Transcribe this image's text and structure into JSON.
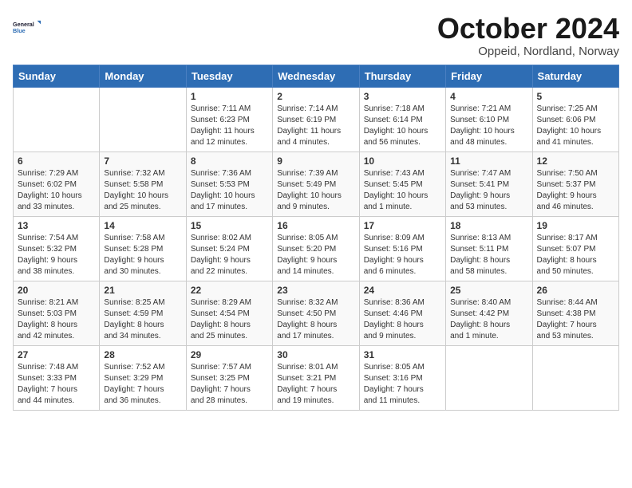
{
  "logo": {
    "text_general": "General",
    "text_blue": "Blue"
  },
  "title": "October 2024",
  "subtitle": "Oppeid, Nordland, Norway",
  "days_of_week": [
    "Sunday",
    "Monday",
    "Tuesday",
    "Wednesday",
    "Thursday",
    "Friday",
    "Saturday"
  ],
  "weeks": [
    [
      {
        "day": "",
        "info": ""
      },
      {
        "day": "",
        "info": ""
      },
      {
        "day": "1",
        "info": "Sunrise: 7:11 AM\nSunset: 6:23 PM\nDaylight: 11 hours\nand 12 minutes."
      },
      {
        "day": "2",
        "info": "Sunrise: 7:14 AM\nSunset: 6:19 PM\nDaylight: 11 hours\nand 4 minutes."
      },
      {
        "day": "3",
        "info": "Sunrise: 7:18 AM\nSunset: 6:14 PM\nDaylight: 10 hours\nand 56 minutes."
      },
      {
        "day": "4",
        "info": "Sunrise: 7:21 AM\nSunset: 6:10 PM\nDaylight: 10 hours\nand 48 minutes."
      },
      {
        "day": "5",
        "info": "Sunrise: 7:25 AM\nSunset: 6:06 PM\nDaylight: 10 hours\nand 41 minutes."
      }
    ],
    [
      {
        "day": "6",
        "info": "Sunrise: 7:29 AM\nSunset: 6:02 PM\nDaylight: 10 hours\nand 33 minutes."
      },
      {
        "day": "7",
        "info": "Sunrise: 7:32 AM\nSunset: 5:58 PM\nDaylight: 10 hours\nand 25 minutes."
      },
      {
        "day": "8",
        "info": "Sunrise: 7:36 AM\nSunset: 5:53 PM\nDaylight: 10 hours\nand 17 minutes."
      },
      {
        "day": "9",
        "info": "Sunrise: 7:39 AM\nSunset: 5:49 PM\nDaylight: 10 hours\nand 9 minutes."
      },
      {
        "day": "10",
        "info": "Sunrise: 7:43 AM\nSunset: 5:45 PM\nDaylight: 10 hours\nand 1 minute."
      },
      {
        "day": "11",
        "info": "Sunrise: 7:47 AM\nSunset: 5:41 PM\nDaylight: 9 hours\nand 53 minutes."
      },
      {
        "day": "12",
        "info": "Sunrise: 7:50 AM\nSunset: 5:37 PM\nDaylight: 9 hours\nand 46 minutes."
      }
    ],
    [
      {
        "day": "13",
        "info": "Sunrise: 7:54 AM\nSunset: 5:32 PM\nDaylight: 9 hours\nand 38 minutes."
      },
      {
        "day": "14",
        "info": "Sunrise: 7:58 AM\nSunset: 5:28 PM\nDaylight: 9 hours\nand 30 minutes."
      },
      {
        "day": "15",
        "info": "Sunrise: 8:02 AM\nSunset: 5:24 PM\nDaylight: 9 hours\nand 22 minutes."
      },
      {
        "day": "16",
        "info": "Sunrise: 8:05 AM\nSunset: 5:20 PM\nDaylight: 9 hours\nand 14 minutes."
      },
      {
        "day": "17",
        "info": "Sunrise: 8:09 AM\nSunset: 5:16 PM\nDaylight: 9 hours\nand 6 minutes."
      },
      {
        "day": "18",
        "info": "Sunrise: 8:13 AM\nSunset: 5:11 PM\nDaylight: 8 hours\nand 58 minutes."
      },
      {
        "day": "19",
        "info": "Sunrise: 8:17 AM\nSunset: 5:07 PM\nDaylight: 8 hours\nand 50 minutes."
      }
    ],
    [
      {
        "day": "20",
        "info": "Sunrise: 8:21 AM\nSunset: 5:03 PM\nDaylight: 8 hours\nand 42 minutes."
      },
      {
        "day": "21",
        "info": "Sunrise: 8:25 AM\nSunset: 4:59 PM\nDaylight: 8 hours\nand 34 minutes."
      },
      {
        "day": "22",
        "info": "Sunrise: 8:29 AM\nSunset: 4:54 PM\nDaylight: 8 hours\nand 25 minutes."
      },
      {
        "day": "23",
        "info": "Sunrise: 8:32 AM\nSunset: 4:50 PM\nDaylight: 8 hours\nand 17 minutes."
      },
      {
        "day": "24",
        "info": "Sunrise: 8:36 AM\nSunset: 4:46 PM\nDaylight: 8 hours\nand 9 minutes."
      },
      {
        "day": "25",
        "info": "Sunrise: 8:40 AM\nSunset: 4:42 PM\nDaylight: 8 hours\nand 1 minute."
      },
      {
        "day": "26",
        "info": "Sunrise: 8:44 AM\nSunset: 4:38 PM\nDaylight: 7 hours\nand 53 minutes."
      }
    ],
    [
      {
        "day": "27",
        "info": "Sunrise: 7:48 AM\nSunset: 3:33 PM\nDaylight: 7 hours\nand 44 minutes."
      },
      {
        "day": "28",
        "info": "Sunrise: 7:52 AM\nSunset: 3:29 PM\nDaylight: 7 hours\nand 36 minutes."
      },
      {
        "day": "29",
        "info": "Sunrise: 7:57 AM\nSunset: 3:25 PM\nDaylight: 7 hours\nand 28 minutes."
      },
      {
        "day": "30",
        "info": "Sunrise: 8:01 AM\nSunset: 3:21 PM\nDaylight: 7 hours\nand 19 minutes."
      },
      {
        "day": "31",
        "info": "Sunrise: 8:05 AM\nSunset: 3:16 PM\nDaylight: 7 hours\nand 11 minutes."
      },
      {
        "day": "",
        "info": ""
      },
      {
        "day": "",
        "info": ""
      }
    ]
  ]
}
